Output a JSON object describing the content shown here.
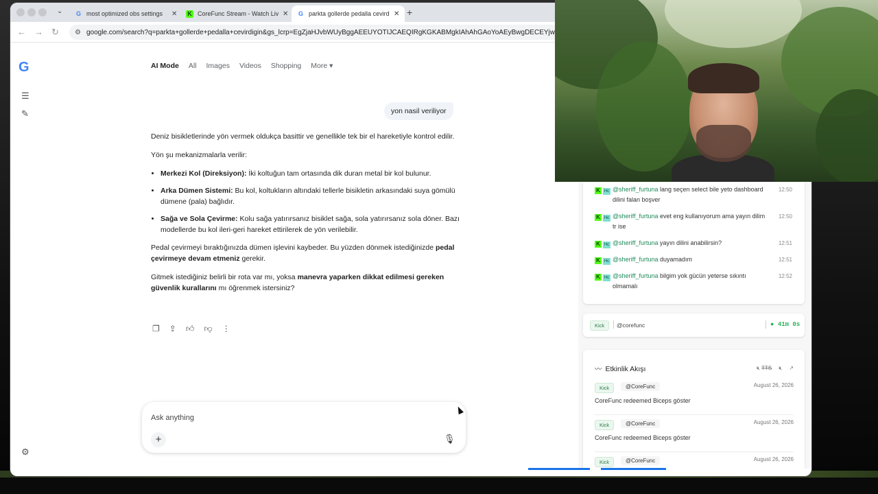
{
  "browser": {
    "tabs": [
      {
        "title": "most optimized obs settings",
        "favicon": "google-icon",
        "active": false
      },
      {
        "title": "CoreFunc Stream - Watch Live",
        "favicon": "kick-icon",
        "active": false
      },
      {
        "title": "parkta gollerde pedalla cevirdigin",
        "favicon": "google-icon",
        "active": true
      }
    ],
    "new_tab": "+",
    "url": "google.com/search?q=parkta+gollerde+pedalla+cevirdigin&gs_lcrp=EgZjaHJvbWUyBggAEEUYOTIJCAEQIRgKGKABMgkIAhAhGAoYoAEyBwgDECEYjwIy"
  },
  "google": {
    "nav": [
      "AI Mode",
      "All",
      "Images",
      "Videos",
      "Shopping",
      "More"
    ],
    "user_query": "yon nasil veriliyor",
    "answer": {
      "p1": "Deniz bisikletlerinde yön vermek oldukça basittir ve genellikle tek bir el hareketiyle kontrol edilir.",
      "p2": "Yön şu mekanizmalarla verilir:",
      "bullets": [
        {
          "bold": "Merkezi Kol (Direksiyon):",
          "text": " İki koltuğun tam ortasında dik duran metal bir kol bulunur."
        },
        {
          "bold": "Arka Dümen Sistemi:",
          "text": " Bu kol, koltukların altındaki tellerle bisikletin arkasındaki suya gömülü dümene (pala) bağlıdır."
        },
        {
          "bold": "Sağa ve Sola Çevirme:",
          "text": " Kolu sağa yatırırsanız bisiklet sağa, sola yatırırsanız sola döner. Bazı modellerde bu kol ileri-geri hareket ettirilerek de yön verilebilir."
        }
      ],
      "p3_a": "Pedal çevirmeyi bıraktığınızda dümen işlevini kaybeder. Bu yüzden dönmek istediğinizde ",
      "p3_b": "pedal çevirmeye devam etmeniz",
      "p3_c": " gerekir.",
      "p4_a": "Gitmek istediğiniz belirli bir rota var mı, yoksa ",
      "p4_b": "manevra yaparken dikkat edilmesi gereken güvenlik kurallarını",
      "p4_c": " mı öğrenmek istersiniz?"
    },
    "ask_placeholder": "Ask anything"
  },
  "chat": {
    "messages": [
      {
        "user": "@sheriff_furtuna",
        "text": "lang seçen select bile yeto dashboard dilini falan boşver",
        "time": "12:50"
      },
      {
        "user": "@sheriff_furtuna",
        "text": "evet eng kullanıyorum ama yayın dilim tr ise",
        "time": "12:50"
      },
      {
        "user": "@sheriff_furtuna",
        "text": "yayın dilini anabilirsin?",
        "time": "12:51"
      },
      {
        "user": "@sheriff_furtuna",
        "text": "duyamadım",
        "time": "12:51"
      },
      {
        "user": "@sheriff_furtuna",
        "text": "bilgim yok gücün yeterse sıkıntı olmamalı",
        "time": "12:52"
      }
    ]
  },
  "stream_status": {
    "platform": "Kick",
    "handle": "@corefunc",
    "uptime": "41m 0s"
  },
  "activity": {
    "title": "Etkinlik Akışı",
    "tts_label": "TTS",
    "events": [
      {
        "platform": "Kick",
        "user": "@CoreFunc",
        "date": "August 26, 2026",
        "text": "CoreFunc redeemed Biceps göster"
      },
      {
        "platform": "Kick",
        "user": "@CoreFunc",
        "date": "August 26, 2026",
        "text": "CoreFunc redeemed Biceps göster"
      },
      {
        "platform": "Kick",
        "user": "@CoreFunc",
        "date": "August 26, 2026",
        "text": ""
      }
    ]
  }
}
